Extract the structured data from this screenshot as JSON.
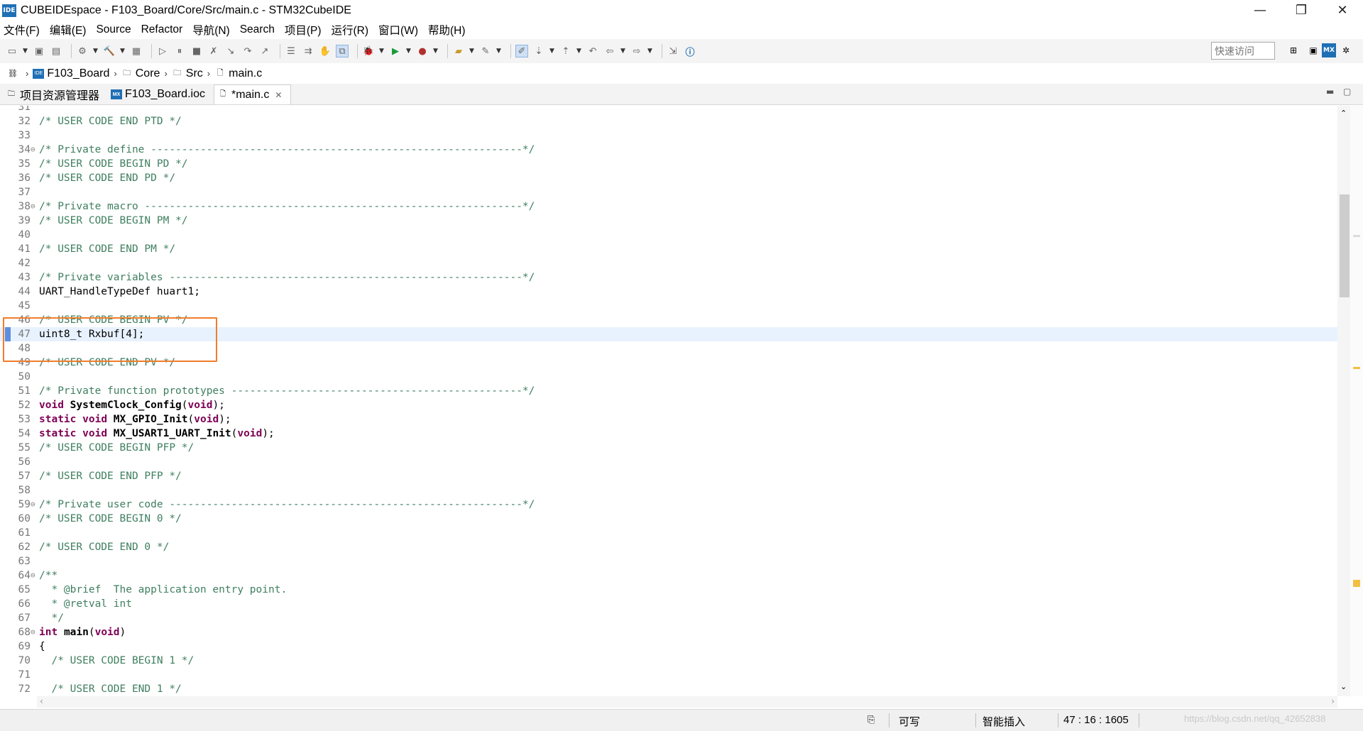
{
  "window": {
    "title": "CUBEIDEspace - F103_Board/Core/Src/main.c - STM32CubeIDE",
    "app_icon_label": "IDE",
    "controls": [
      "—",
      "❐",
      "✕"
    ]
  },
  "menu": [
    "文件(F)",
    "编辑(E)",
    "Source",
    "Refactor",
    "导航(N)",
    "Search",
    "项目(P)",
    "运行(R)",
    "窗口(W)",
    "帮助(H)"
  ],
  "toolbar": {
    "quick_access_placeholder": "快速访问",
    "mx_label": "MX"
  },
  "breadcrumb": [
    "F103_Board",
    "Core",
    "Src",
    "main.c"
  ],
  "tabs": [
    {
      "label": "项目资源管理器",
      "active": false
    },
    {
      "label": "F103_Board.ioc",
      "active": false
    },
    {
      "label": "*main.c",
      "active": true
    }
  ],
  "editor": {
    "current_line": 47,
    "lines": [
      {
        "n": "31",
        "t": ""
      },
      {
        "n": "32",
        "t": "/* USER CODE END PTD */"
      },
      {
        "n": "33",
        "t": ""
      },
      {
        "n": "34",
        "t": "/* Private define ------------------------------------------------------------*/"
      },
      {
        "n": "35",
        "t": "/* USER CODE BEGIN PD */"
      },
      {
        "n": "36",
        "t": "/* USER CODE END PD */"
      },
      {
        "n": "37",
        "t": ""
      },
      {
        "n": "38",
        "t": "/* Private macro -------------------------------------------------------------*/"
      },
      {
        "n": "39",
        "t": "/* USER CODE BEGIN PM */"
      },
      {
        "n": "40",
        "t": ""
      },
      {
        "n": "41",
        "t": "/* USER CODE END PM */"
      },
      {
        "n": "42",
        "t": ""
      },
      {
        "n": "43",
        "t": "/* Private variables ---------------------------------------------------------*/"
      },
      {
        "n": "44",
        "t": "UART_HandleTypeDef huart1;"
      },
      {
        "n": "45",
        "t": ""
      },
      {
        "n": "46",
        "t": "/* USER CODE BEGIN PV */"
      },
      {
        "n": "47",
        "t": "uint8_t Rxbuf[4];"
      },
      {
        "n": "48",
        "t": ""
      },
      {
        "n": "49",
        "t": "/* USER CODE END PV */"
      },
      {
        "n": "50",
        "t": ""
      },
      {
        "n": "51",
        "t": "/* Private function prototypes -----------------------------------------------*/"
      },
      {
        "n": "52",
        "t": "void SystemClock_Config(void);"
      },
      {
        "n": "53",
        "t": "static void MX_GPIO_Init(void);"
      },
      {
        "n": "54",
        "t": "static void MX_USART1_UART_Init(void);"
      },
      {
        "n": "55",
        "t": "/* USER CODE BEGIN PFP */"
      },
      {
        "n": "56",
        "t": ""
      },
      {
        "n": "57",
        "t": "/* USER CODE END PFP */"
      },
      {
        "n": "58",
        "t": ""
      },
      {
        "n": "59",
        "t": "/* Private user code ---------------------------------------------------------*/"
      },
      {
        "n": "60",
        "t": "/* USER CODE BEGIN 0 */"
      },
      {
        "n": "61",
        "t": ""
      },
      {
        "n": "62",
        "t": "/* USER CODE END 0 */"
      },
      {
        "n": "63",
        "t": ""
      },
      {
        "n": "64",
        "t": "/**"
      },
      {
        "n": "65",
        "t": "  * @brief  The application entry point."
      },
      {
        "n": "66",
        "t": "  * @retval int"
      },
      {
        "n": "67",
        "t": "  */"
      },
      {
        "n": "68",
        "t": "int main(void)"
      },
      {
        "n": "69",
        "t": "{"
      },
      {
        "n": "70",
        "t": "  /* USER CODE BEGIN 1 */"
      },
      {
        "n": "71",
        "t": ""
      },
      {
        "n": "72",
        "t": "  /* USER CODE END 1 */"
      }
    ]
  },
  "status": {
    "writable": "可写",
    "insert_mode": "智能插入",
    "position": "47 : 16 : 1605",
    "watermark": "https://blog.csdn.net/qq_42652838"
  }
}
